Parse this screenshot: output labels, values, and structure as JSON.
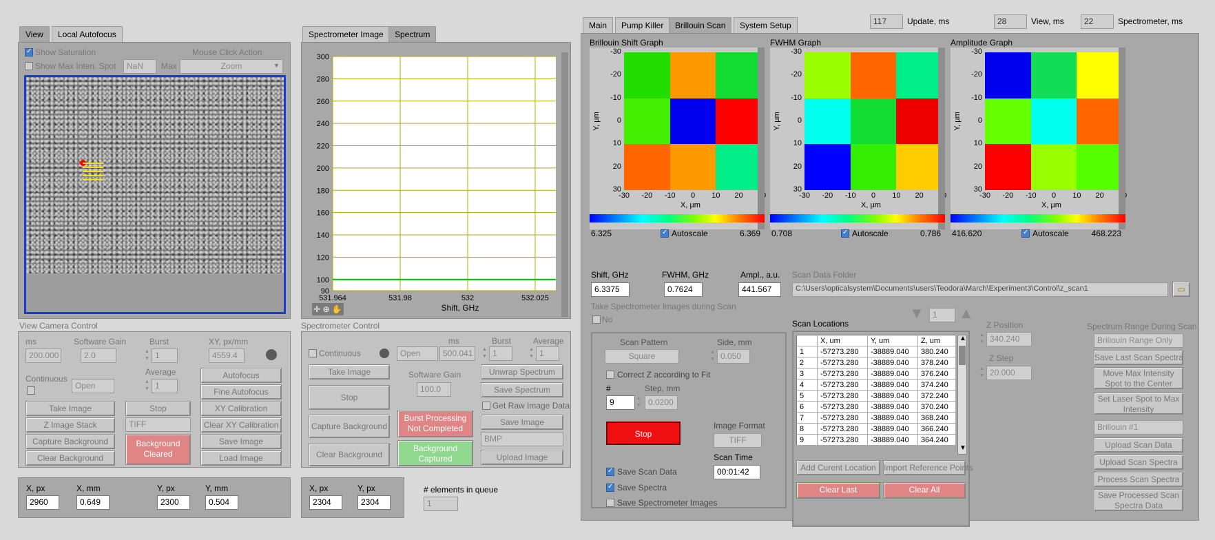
{
  "left_tabs": [
    "View",
    "Local Autofocus"
  ],
  "view": {
    "show_saturation": "Show Saturation",
    "show_max_inten": "Show Max Inten. Spot",
    "nan_value": "NaN",
    "max_label": "Max",
    "mouse_click_label": "Mouse Click Action",
    "mouse_click_value": "Zoom"
  },
  "camera_control": {
    "title": "View Camera Control",
    "ms_label": "ms",
    "ms_value": "200.000",
    "gain_label": "Software Gain",
    "gain_value": "2.0",
    "burst_label": "Burst",
    "burst_value": "1",
    "xy_label": "XY, px/mm",
    "xy_value": "4559.4",
    "continuous_label": "Continuous",
    "open_value": "Open",
    "average_label": "Average",
    "average_value": "1",
    "buttons": [
      "Autofocus",
      "Fine Autofocus",
      "Take Image",
      "Stop",
      "XY Calibration",
      "Z Image Stack",
      "TIFF",
      "Clear XY Calibration",
      "Capture Background",
      "Save Image",
      "Clear Background",
      "Load Image"
    ],
    "bg_status": "Background Cleared"
  },
  "coords_left": {
    "x_px_label": "X, px",
    "x_px": "2960",
    "x_mm_label": "X, mm",
    "x_mm": "0.649",
    "y_px_label": "Y, px",
    "y_px": "2300",
    "y_mm_label": "Y, mm",
    "y_mm": "0.504"
  },
  "middle_tabs": [
    "Spectrometer Image",
    "Spectrum"
  ],
  "spectrum_chart": {
    "ylim": [
      90,
      300
    ],
    "yticks": [
      "300",
      "280",
      "260",
      "240",
      "220",
      "200",
      "180",
      "160",
      "140",
      "120",
      "100",
      "90"
    ],
    "xticks": [
      "531.964",
      "531.98",
      "532",
      "532.025"
    ],
    "xlabel": "Shift, GHz",
    "line_value": 100,
    "line_color": "#00c000"
  },
  "spectrometer_control": {
    "title": "Spectrometer Control",
    "continuous_label": "Continuous",
    "ms_label": "ms",
    "burst_label": "Burst",
    "average_label": "Average",
    "open_value": "Open",
    "ms_value": "500.041",
    "burst_value": "1",
    "average_value": "1",
    "take_image": "Take Image",
    "unwrap": "Unwrap Spectrum",
    "gain_label": "Software Gain",
    "gain_value": "100.0",
    "save_spectrum": "Save Spectrum",
    "stop": "Stop",
    "raw_label": "Get Raw Image Data",
    "capture_bg": "Capture Background",
    "burst_status": "Burst Processing Not Completed",
    "save_image": "Save Image",
    "bmp": "BMP",
    "clear_bg": "Clear Background",
    "bg_status": "Background Captured",
    "upload_image": "Upload Image"
  },
  "coords_middle": {
    "x_px_label": "X, px",
    "x_px": "2304",
    "y_px_label": "Y, px",
    "y_px": "2304"
  },
  "queue": {
    "label": "# elements in queue",
    "value": "1"
  },
  "top_right": {
    "update_value": "117",
    "update_label": "Update, ms",
    "view_value": "28",
    "view_label": "View, ms",
    "spectrometer_value": "22",
    "spectrometer_label": "Spectrometer, ms"
  },
  "right_tabs": [
    "Main",
    "Pump Killer",
    "Brillouin Scan",
    "System Setup"
  ],
  "graphs": [
    {
      "title": "Brillouin Shift Graph",
      "colors": [
        [
          "#22dd00",
          "#ff9900",
          "#11dd33"
        ],
        [
          "#44ee00",
          "#0000ee",
          "#ff0000"
        ],
        [
          "#ff6600",
          "#ff9900",
          "#00ee88"
        ]
      ],
      "min": "6.325",
      "max": "6.369",
      "autoscale": "Autoscale",
      "xticks": [
        "-30",
        "-20",
        "-10",
        "0",
        "10",
        "20",
        "30"
      ],
      "yticks": [
        "-30",
        "-20",
        "-10",
        "0",
        "10",
        "20",
        "30"
      ],
      "xlabel": "X, µm",
      "ylabel": "Y, µm"
    },
    {
      "title": "FWHM Graph",
      "colors": [
        [
          "#99ff00",
          "#ff6600",
          "#00ee88"
        ],
        [
          "#00ffee",
          "#11dd33",
          "#ee0000"
        ],
        [
          "#0000ff",
          "#33ee00",
          "#ffcc00"
        ]
      ],
      "min": "0.708",
      "max": "0.786",
      "autoscale": "Autoscale",
      "xticks": [
        "-30",
        "-20",
        "-10",
        "0",
        "10",
        "20",
        "30"
      ],
      "yticks": [
        "-30",
        "-20",
        "-10",
        "0",
        "10",
        "20",
        "30"
      ],
      "xlabel": "X, µm",
      "ylabel": "Y, µm"
    },
    {
      "title": "Amplitude Graph",
      "colors": [
        [
          "#0000ee",
          "#11dd55",
          "#ffff00"
        ],
        [
          "#66ff00",
          "#00ffee",
          "#ff6600"
        ],
        [
          "#ff0000",
          "#99ff00",
          "#55ff00"
        ]
      ],
      "min": "416.620",
      "max": "468.223",
      "autoscale": "Autoscale",
      "xticks": [
        "-30",
        "-20",
        "-10",
        "0",
        "10",
        "20",
        "30"
      ],
      "yticks": [
        "-30",
        "-20",
        "-10",
        "0",
        "10",
        "20",
        "30"
      ],
      "xlabel": "X, µm",
      "ylabel": "Y, µm"
    }
  ],
  "readouts": {
    "shift_label": "Shift, GHz",
    "shift_value": "6.3375",
    "fwhm_label": "FWHM, GHz",
    "fwhm_value": "0.7624",
    "ampl_label": "Ampl., a.u.",
    "ampl_value": "441.567"
  },
  "scan_folder": {
    "label": "Scan Data Folder",
    "path": "C:\\Users\\opticalsystem\\Documents\\users\\Teodora\\March\\Experiment3\\Control\\z_scan1"
  },
  "take_images_label": "Take Spectrometer Images during Scan",
  "take_images_value": "No",
  "nav_value": "1",
  "scan_settings": {
    "pattern_label": "Scan Pattern",
    "pattern_value": "Square",
    "side_label": "Side, mm",
    "side_value": "0.050",
    "correct_z": "Correct Z according to Fit",
    "num_label": "#",
    "num_value": "9",
    "step_label": "Step, mm",
    "step_value": "0.0200",
    "stop": "Stop",
    "format_label": "Image Format",
    "format_value": "TIFF",
    "scan_time_label": "Scan Time",
    "scan_time_value": "00:01:42",
    "save_scan": "Save Scan Data",
    "save_spectra": "Save Spectra",
    "save_images": "Save Spectrometer Images"
  },
  "scan_locations": {
    "title": "Scan Locations",
    "headers": [
      "X, um",
      "Y, um",
      "Z, um"
    ],
    "rows": [
      [
        "1",
        "-57273.280",
        "-38889.040",
        "380.240"
      ],
      [
        "2",
        "-57273.280",
        "-38889.040",
        "378.240"
      ],
      [
        "3",
        "-57273.280",
        "-38889.040",
        "376.240"
      ],
      [
        "4",
        "-57273.280",
        "-38889.040",
        "374.240"
      ],
      [
        "5",
        "-57273.280",
        "-38889.040",
        "372.240"
      ],
      [
        "6",
        "-57273.280",
        "-38889.040",
        "370.240"
      ],
      [
        "7",
        "-57273.280",
        "-38889.040",
        "368.240"
      ],
      [
        "8",
        "-57273.280",
        "-38889.040",
        "366.240"
      ],
      [
        "9",
        "-57273.280",
        "-38889.040",
        "364.240"
      ]
    ],
    "add_current": "Add Curent Location",
    "import_ref": "Import Reference Points",
    "clear_last": "Clear Last",
    "clear_all": "Clear All"
  },
  "z_panel": {
    "z_pos_label": "Z Position",
    "z_pos_value": "340.240",
    "z_step_label": "Z Step",
    "z_step_value": "20.000"
  },
  "spectrum_range": {
    "label": "Spectrum Range During Scan",
    "value": "Brillouin Range Only",
    "buttons": [
      "Save Last Scan Spectra",
      "Move Max Intensity Spot to the Center",
      "Set Laser Spot to Max Intensity"
    ],
    "brillouin_select": "Brillouin #1",
    "buttons2": [
      "Upload Scan Data",
      "Upload Scan Spectra",
      "Process Scan Spectra",
      "Save Processed Scan Spectra Data"
    ]
  }
}
